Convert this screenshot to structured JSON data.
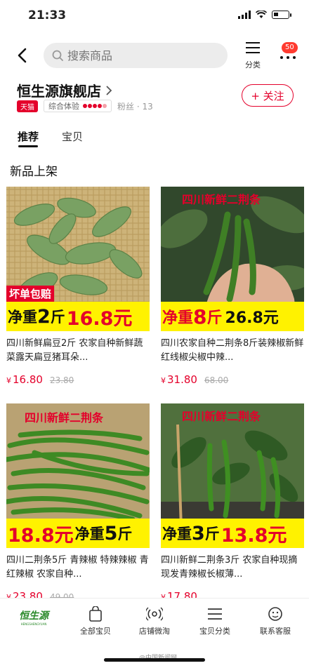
{
  "status": {
    "time": "21:33"
  },
  "header": {
    "search_placeholder": "搜索商品",
    "category_label": "分类",
    "badge_count": "50"
  },
  "shop": {
    "name": "恒生源旗舰店",
    "tmall_tag": "天猫",
    "rating_label": "综合体验",
    "fans": "粉丝 · 13",
    "follow_label": "+ 关注"
  },
  "tabs": [
    {
      "label": "推荐"
    },
    {
      "label": "宝贝"
    }
  ],
  "section_title": "新品上架",
  "products": [
    {
      "title": "四川新鲜扁豆2斤 农家自种新鲜蔬菜露天扁豆猪耳朵...",
      "currency": "¥",
      "price": "16.80",
      "old_price": "23.80",
      "img_tag": "坏单包赔",
      "banner_a": "净重",
      "banner_b": "2",
      "banner_c": "斤",
      "banner_d": "16.8元"
    },
    {
      "title": "四川农家自种二荆条8斤装辣椒新鲜红线椒尖椒中辣...",
      "currency": "¥",
      "price": "31.80",
      "old_price": "68.00",
      "img_tag": "四川新鲜二荆条",
      "banner_a": "净重",
      "banner_b": "8",
      "banner_c": "斤",
      "banner_d": "26.8元"
    },
    {
      "title": "四川二荆条5斤 青辣椒 特辣辣椒 青红辣椒 农家自种...",
      "currency": "¥",
      "price": "23.80",
      "old_price": "49.00",
      "img_tag": "四川新鲜二荆条",
      "banner_a": "18.8元",
      "banner_b": "净重",
      "banner_c": "5",
      "banner_d": "斤"
    },
    {
      "title": "四川新鲜二荆条3斤 农家自种现摘现发青辣椒长椒薄...",
      "currency": "¥",
      "price": "17.80",
      "old_price": "",
      "img_tag": "四川新鲜二荆条",
      "banner_a": "净重",
      "banner_b": "3",
      "banner_c": "斤",
      "banner_d": "13.8元"
    }
  ],
  "bottom_nav": {
    "logo_text": "恒生源",
    "logo_sub": "HENGSHENGYUAN",
    "items": [
      {
        "label": "全部宝贝"
      },
      {
        "label": "店铺微淘"
      },
      {
        "label": "宝贝分类"
      },
      {
        "label": "联系客服"
      }
    ]
  },
  "watermark": "@中国新闻网"
}
